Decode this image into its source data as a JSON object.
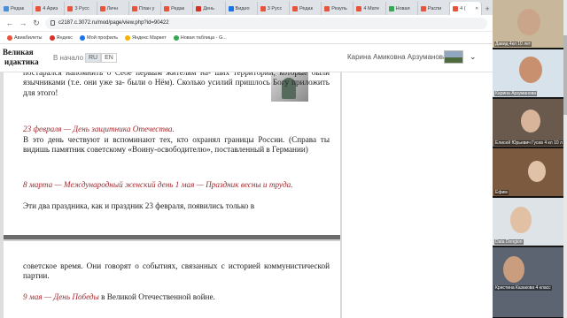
{
  "browser": {
    "tabs": [
      {
        "label": "Редак",
        "color": "#4a90d9"
      },
      {
        "label": "4 Ариз",
        "color": "#e8533c"
      },
      {
        "label": "3 Русс",
        "color": "#e8533c"
      },
      {
        "label": "Личн",
        "color": "#e8533c"
      },
      {
        "label": "План у",
        "color": "#e8533c"
      },
      {
        "label": "Редак",
        "color": "#e8533c"
      },
      {
        "label": "День",
        "color": "#d93025"
      },
      {
        "label": "Видео",
        "color": "#1a73e8"
      },
      {
        "label": "3 Русс",
        "color": "#e8533c"
      },
      {
        "label": "Редак",
        "color": "#e8533c"
      },
      {
        "label": "Резуль",
        "color": "#e8533c"
      },
      {
        "label": "4 Мате",
        "color": "#e8533c"
      },
      {
        "label": "Новая",
        "color": "#34a853"
      },
      {
        "label": "Распи",
        "color": "#e8533c"
      },
      {
        "label": "4 (",
        "color": "#e8533c"
      }
    ],
    "address": "c2187.c.3072.ru/mod/page/view.php?id=90422",
    "bookmarks": [
      {
        "label": "Авиабилеты",
        "color": "#e8533c"
      },
      {
        "label": "Яндекс",
        "color": "#d93025"
      },
      {
        "label": "Мой профиль",
        "color": "#1a73e8"
      },
      {
        "label": "Яндекс Маркет",
        "color": "#f4b400"
      },
      {
        "label": "Новая таблица - G...",
        "color": "#34a853"
      }
    ]
  },
  "site": {
    "logo_line1": "Великая",
    "logo_line2": "идактика",
    "home": "В начало",
    "lang_ru": "RU",
    "lang_en": "EN",
    "user": "Карина Амиковна Арзуманова"
  },
  "article": {
    "p0": "постарался напомнить о Себе первым жителям на- ших территорий, которые были язычниками (т.е. они уже за- были о Нём). Сколько усилий пришлось Богу приложить для этого!",
    "h1": "23 февраля — День защитника Отечества.",
    "p1": "В это день чествуют и вспоминают тех, кто охранял границы России. (Справа ты видишь памятник советскому «Воину-освободителю», поставленный в Германии)",
    "h2": "8 марта — Международный женский день 1 мая — Праздник весны и труда.",
    "p2": "Эти два праздника, как и праздник 23 февраля, появились только в",
    "p3": "советское время. Они говорят о событиях, связанных с историей коммунистической партии.",
    "h3": "9 мая — День Победы",
    "p4": " в Великой Отечественной войне."
  },
  "participants": [
    {
      "name": "Давид 4кл 10 лет",
      "bg": "#c8b79a",
      "skin": "#caa58a"
    },
    {
      "name": "Карина Арзуманова",
      "bg": "#d7e2ea",
      "skin": "#c9906f"
    },
    {
      "name": "Елисей Юрьевич Гусев 4 кл 10 л",
      "bg": "#6a5a4e",
      "skin": "#d8b59a"
    },
    {
      "name": "Ефим",
      "bg": "#7b5a3f",
      "skin": "#e0c2a8"
    },
    {
      "name": "Data Dongion",
      "bg": "#dde3e6",
      "skin": "#e2c0a3"
    },
    {
      "name": "Кристина Казакова 4 класс",
      "bg": "#5b6470",
      "skin": "#c99d7e"
    }
  ]
}
